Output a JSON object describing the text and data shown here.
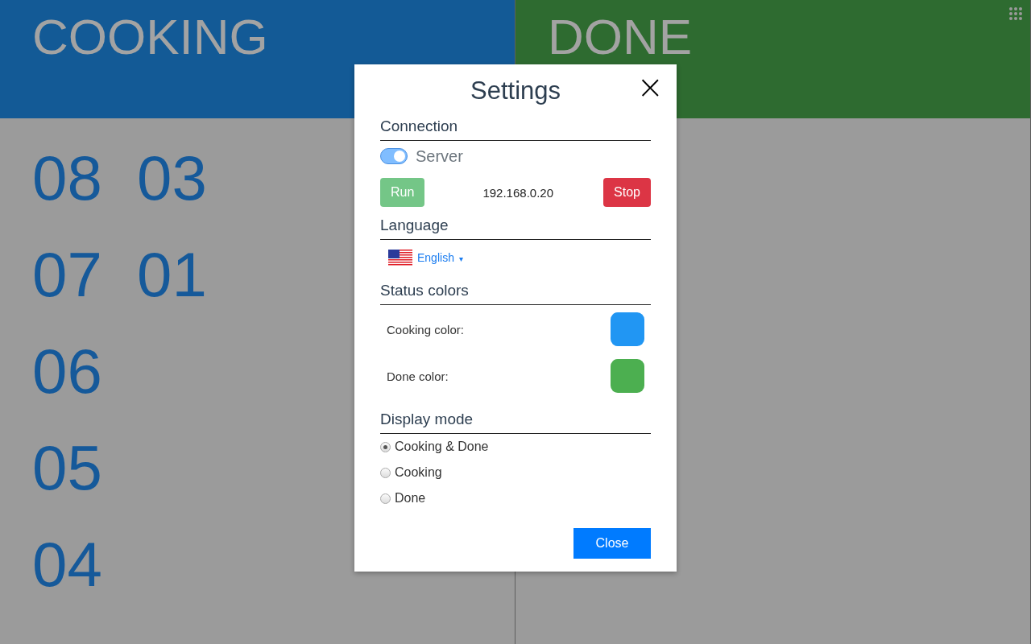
{
  "columns": [
    {
      "title": "COOKING",
      "color": "#135a96",
      "order_rows": [
        [
          "08",
          "03"
        ],
        [
          "07",
          "01"
        ],
        [
          "06"
        ],
        [
          "05"
        ],
        [
          "04"
        ]
      ]
    },
    {
      "title": "DONE",
      "color": "#2e6b30"
    }
  ],
  "settings": {
    "title": "Settings",
    "close_symbol": "×",
    "connection": {
      "heading": "Connection",
      "server_label": "Server",
      "server_on": true,
      "run_label": "Run",
      "address": "192.168.0.20",
      "stop_label": "Stop"
    },
    "language": {
      "heading": "Language",
      "value": "English",
      "caret": "▾"
    },
    "status_colors": {
      "heading": "Status colors",
      "items": [
        {
          "label": "Cooking color:",
          "color": "#2196f3"
        },
        {
          "label": "Done color:",
          "color": "#4caf50"
        }
      ]
    },
    "display_mode": {
      "heading": "Display mode",
      "options": [
        {
          "label": "Cooking & Done",
          "selected": true
        },
        {
          "label": "Cooking",
          "selected": false
        },
        {
          "label": "Done",
          "selected": false
        }
      ]
    },
    "close_label": "Close"
  }
}
